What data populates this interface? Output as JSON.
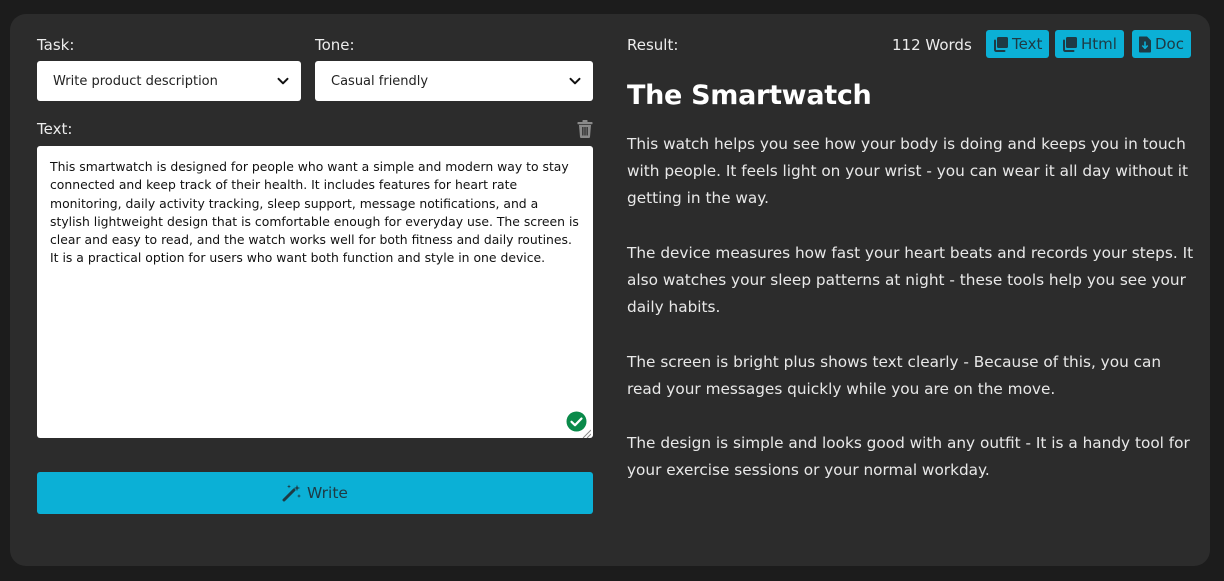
{
  "task": {
    "label": "Task:",
    "selected": "Write product description"
  },
  "tone": {
    "label": "Tone:",
    "selected": "Casual friendly"
  },
  "text": {
    "label": "Text:",
    "value": "This smartwatch is designed for people who want a simple and modern way to stay connected and keep track of their health. It includes features for heart rate monitoring, daily activity tracking, sleep support, message notifications, and a stylish lightweight design that is comfortable enough for everyday use. The screen is clear and easy to read, and the watch works well for both fitness and daily routines. It is a practical option for users who want both function and style in one device."
  },
  "write_button": {
    "label": "Write"
  },
  "result": {
    "label": "Result:",
    "word_count": "112 Words",
    "buttons": {
      "text": "Text",
      "html": "Html",
      "doc": "Doc"
    },
    "title": "The Smartwatch",
    "paragraphs": [
      "This watch helps you see how your body is doing and keeps you in touch with people. It feels light on your wrist - you can wear it all day without it getting in the way.",
      "The device measures how fast your heart beats and records your steps. It also watches your sleep patterns at night - these tools help you see your daily habits.",
      "The screen is bright plus shows text clearly - Because of this, you can read your messages quickly while you are on the move.",
      "The design is simple and looks good with any outfit - It is a handy tool for your exercise sessions or your normal workday."
    ]
  },
  "colors": {
    "page_bg": "#1c1c1c",
    "panel_bg": "#2c2c2c",
    "accent": "#0bb0d6",
    "success": "#0a8a4a"
  },
  "icons": {
    "chevron": "chevron-down-icon",
    "trash": "trash-icon",
    "check": "check-circle-icon",
    "wand": "magic-wand-icon",
    "copy": "copy-icon",
    "download": "file-download-icon"
  }
}
